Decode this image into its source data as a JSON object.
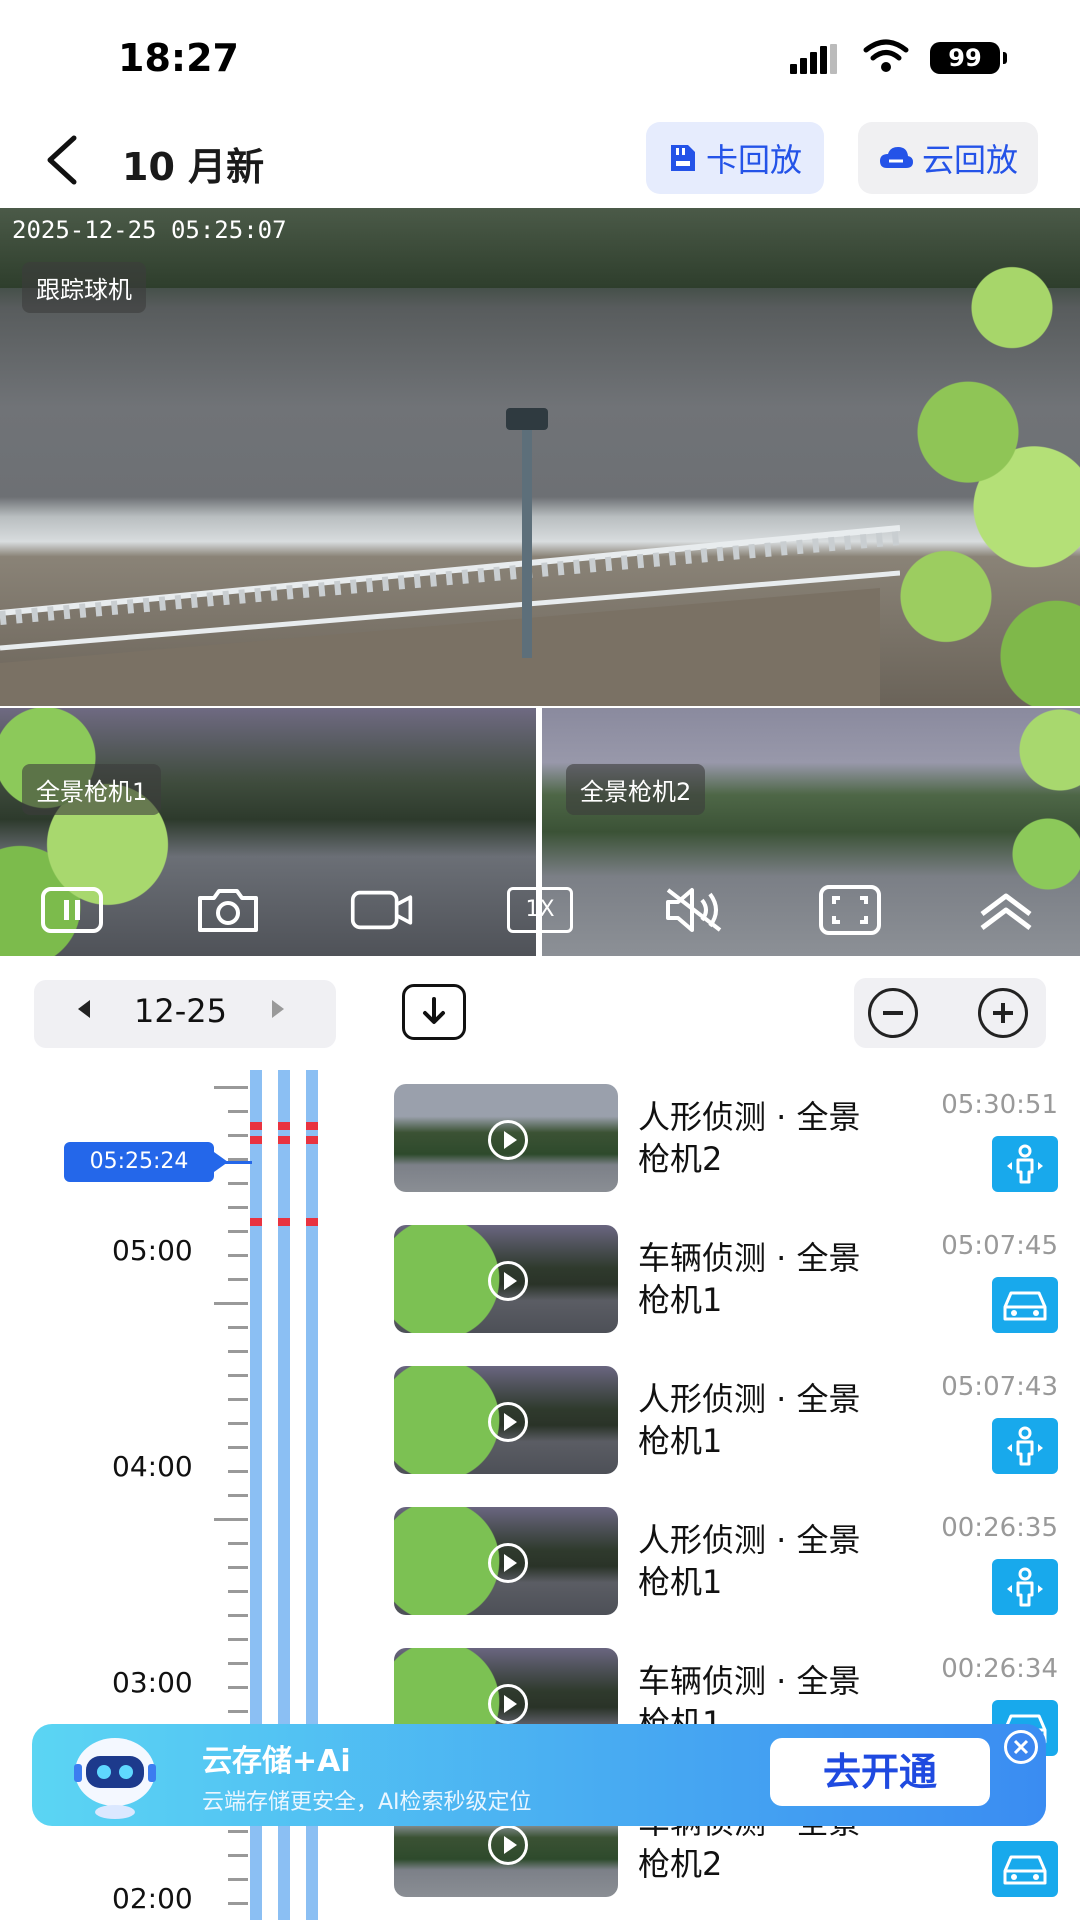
{
  "status_bar": {
    "time": "18:27",
    "battery": "99"
  },
  "header": {
    "title": "10 月新",
    "card_playback": "卡回放",
    "cloud_playback": "云回放"
  },
  "main_video": {
    "timestamp": "2025-12-25 05:25:07",
    "camera_label": "跟踪球机"
  },
  "sub_videos": [
    {
      "label": "全景枪机1"
    },
    {
      "label": "全景枪机2"
    }
  ],
  "controls": {
    "speed": "1X"
  },
  "date_selector": {
    "date": "12-25"
  },
  "timeline": {
    "cursor_time": "05:25:24",
    "labels": [
      "05:00",
      "04:00",
      "03:00",
      "02:00"
    ]
  },
  "events": [
    {
      "title": "人形侦测 · 全景枪机2",
      "time": "05:30:51",
      "type": "person",
      "thumb": "pano2"
    },
    {
      "title": "车辆侦测 · 全景枪机1",
      "time": "05:07:45",
      "type": "vehicle",
      "thumb": "pano1"
    },
    {
      "title": "人形侦测 · 全景枪机1",
      "time": "05:07:43",
      "type": "person",
      "thumb": "pano1"
    },
    {
      "title": "人形侦测 · 全景枪机1",
      "time": "00:26:35",
      "type": "person",
      "thumb": "pano1"
    },
    {
      "title": "车辆侦测 · 全景枪机1",
      "time": "00:26:34",
      "type": "vehicle",
      "thumb": "pano1"
    },
    {
      "title": "车辆侦测 · 全景枪机2",
      "time": "",
      "type": "vehicle",
      "thumb": "pano2"
    }
  ],
  "promo": {
    "title": "云存储+Ai",
    "subtitle": "云端存储更安全，AI检索秒级定位",
    "button": "去开通"
  },
  "colors": {
    "accent": "#2453e8",
    "event_icon_bg": "#18a9ec",
    "timeline_bar": "#8bbff3",
    "record_marker": "#e83340"
  }
}
